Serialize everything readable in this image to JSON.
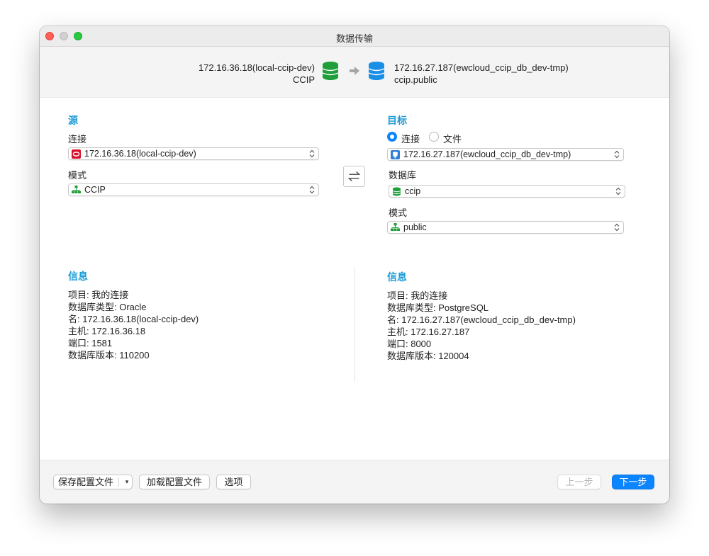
{
  "window": {
    "title": "数据传输"
  },
  "banner": {
    "source_name": "172.16.36.18(local-ccip-dev)",
    "source_schema": "CCIP",
    "target_name": "172.16.27.187(ewcloud_ccip_db_dev-tmp)",
    "target_schema": "ccip.public",
    "source_icon": "database-green-icon",
    "target_icon": "database-blue-icon",
    "arrow_icon": "arrow-right-icon"
  },
  "source": {
    "title": "源",
    "connection_label": "连接",
    "connection_value": "172.16.36.18(local-ccip-dev)",
    "connection_icon": "oracle-icon",
    "schema_label": "模式",
    "schema_value": "CCIP",
    "schema_icon": "schema-icon"
  },
  "target": {
    "title": "目标",
    "radio_connection": "连接",
    "radio_file": "文件",
    "radio_selected": "连接",
    "connection_value": "172.16.27.187(ewcloud_ccip_db_dev-tmp)",
    "connection_icon": "postgresql-icon",
    "database_label": "数据库",
    "database_value": "ccip",
    "database_icon": "database-icon",
    "schema_label": "模式",
    "schema_value": "public",
    "schema_icon": "schema-icon"
  },
  "source_info": {
    "title": "信息",
    "lines": [
      "项目: 我的连接",
      "数据库类型: Oracle",
      "名: 172.16.36.18(local-ccip-dev)",
      "主机: 172.16.36.18",
      "端口: 1581",
      "数据库版本: 110200"
    ]
  },
  "target_info": {
    "title": "信息",
    "lines": [
      "项目: 我的连接",
      "数据库类型: PostgreSQL",
      "名: 172.16.27.187(ewcloud_ccip_db_dev-tmp)",
      "主机: 172.16.27.187",
      "端口: 8000",
      "数据库版本: 120004"
    ]
  },
  "footer": {
    "save_profile": "保存配置文件",
    "save_profile_menu": "▾",
    "load_profile": "加载配置文件",
    "options": "选项",
    "previous": "上一步",
    "next": "下一步"
  },
  "colors": {
    "accent": "#1a9bd7",
    "primary_button": "#0a84ff",
    "db_green": "#1f9e3a",
    "db_blue": "#1a8fe6",
    "oracle_red": "#d8102b"
  }
}
